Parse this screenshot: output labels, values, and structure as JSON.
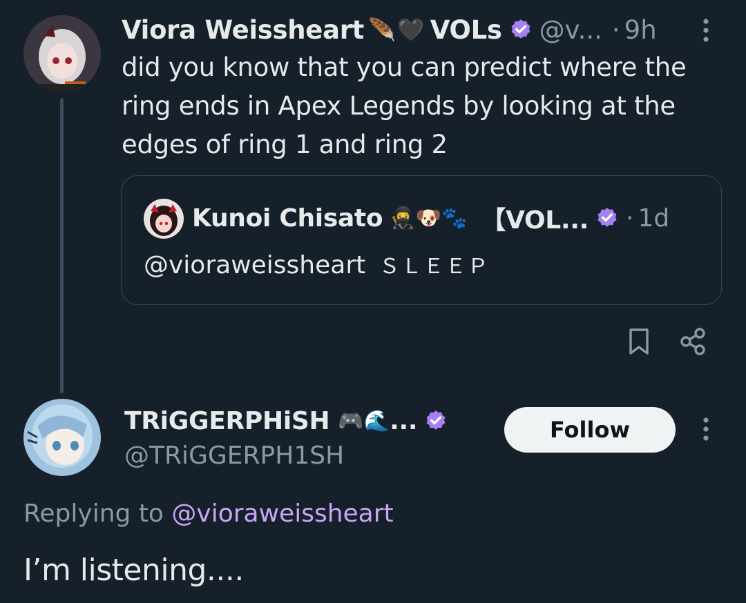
{
  "tweet": {
    "author_name": "Viora Weissheart",
    "name_emoji_1": "🪶",
    "name_emoji_2": "🖤",
    "name_suffix": "VOLs",
    "handle": "@v...",
    "separator": "·",
    "time": "9h",
    "text": "did you know that you can predict where the ring ends in Apex Legends by looking at the edges of ring 1 and ring 2"
  },
  "quote": {
    "author_name": "Kunoi Chisato",
    "name_emojis": "🥷🐶🐾",
    "name_suffix": "【VOL...",
    "separator": "·",
    "time": "1d",
    "mention": "@vioraweissheart",
    "text": "ＳＬＥＥＰ"
  },
  "reply": {
    "author_name": "TRiGGERPHiSH",
    "name_emojis": "🎮🌊",
    "name_ellipsis": "...",
    "handle": "@TRiGGERPH1SH",
    "follow_label": "Follow",
    "replying_prefix": "Replying to",
    "replying_handle": "@vioraweissheart",
    "text": "I’m listening...."
  },
  "colors": {
    "background": "#15202b",
    "text_primary": "#e7e9ea",
    "text_secondary": "#8b98a5",
    "verified_badge": "#a67ff0",
    "mention": "#c9a6f5",
    "follow_button_bg": "#eff3f4"
  },
  "icons": [
    "more-vertical-icon",
    "verified-badge-icon",
    "bookmark-icon",
    "share-icon"
  ]
}
